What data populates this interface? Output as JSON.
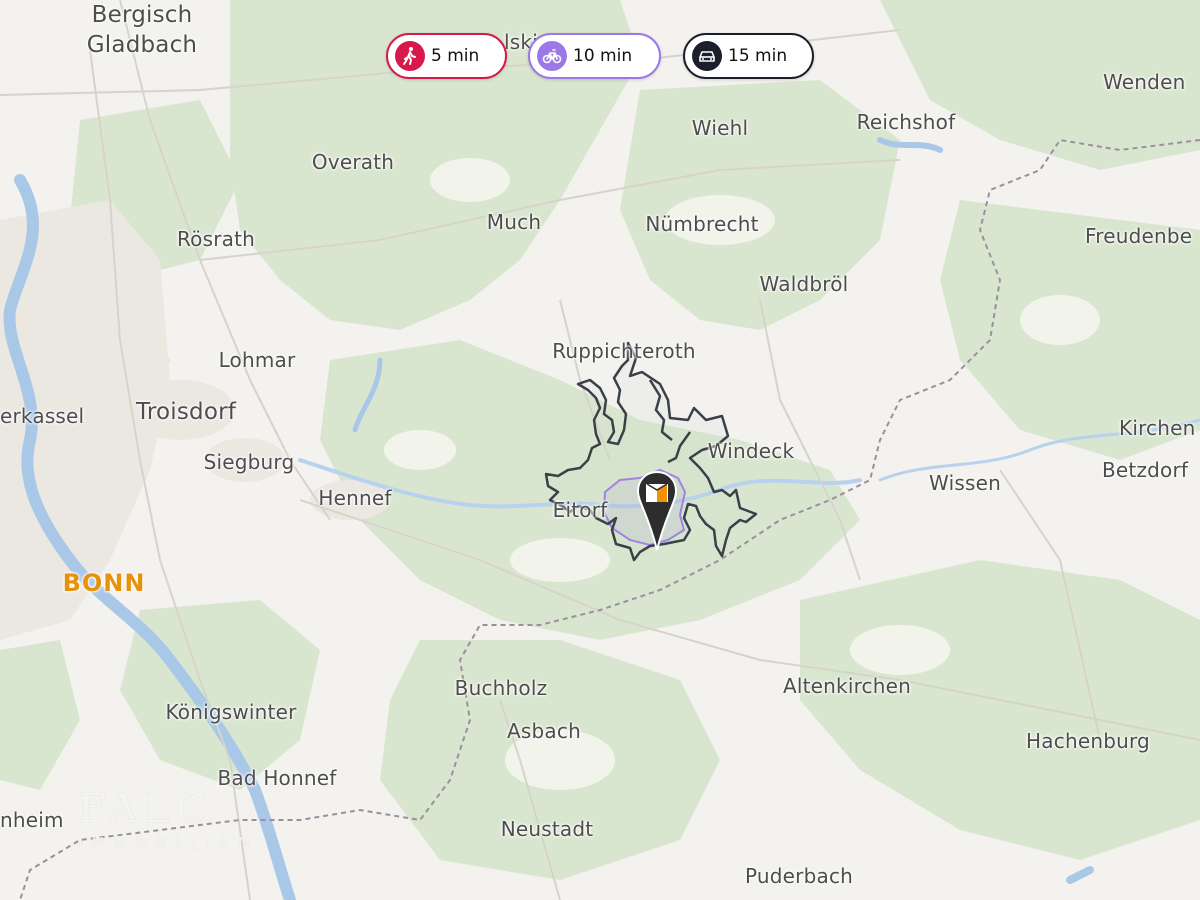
{
  "travel_modes": [
    {
      "mode": "walk",
      "icon": "walking-person-icon",
      "label": "5 min",
      "color": "#d8174b"
    },
    {
      "mode": "bike",
      "icon": "bicycle-icon",
      "label": "10 min",
      "color": "#9c78e6"
    },
    {
      "mode": "car",
      "icon": "car-icon",
      "label": "15 min",
      "color": "#1a1f2b"
    }
  ],
  "places": {
    "bergisch_gladbach": "Bergisch\nGladbach",
    "overath": "Overath",
    "much": "Much",
    "nuembrecht": "Nümbrecht",
    "wiehl": "Wiehl",
    "reichshof": "Reichshof",
    "wenden": "Wenden",
    "freudenberg": "Freudenbe",
    "waldbroel": "Waldbröl",
    "roesrath": "Rösrath",
    "lohmar": "Lohmar",
    "ruppichteroth": "Ruppichteroth",
    "troisdorf": "Troisdorf",
    "niederkassel": "erkassel",
    "siegburg": "Siegburg",
    "hennef": "Hennef",
    "eitorf": "Eitorf",
    "windeck": "Windeck",
    "wissen": "Wissen",
    "kirchen": "Kirchen",
    "betzdorf": "Betzdorf",
    "bonn": "BONN",
    "koenigswinter": "Königswinter",
    "bad_honnef": "Bad Honnef",
    "buchholz": "Buchholz",
    "asbach": "Asbach",
    "altenkirchen": "Altenkirchen",
    "hachenburg": "Hachenburg",
    "neustadt": "Neustadt",
    "puderbach": "Puderbach",
    "bornheim": "nheim",
    "partial_top": "lski"
  },
  "watermark": {
    "line1": "FALC",
    "line2": "IMMOBILIEN"
  },
  "marker": {
    "icon": "property-location-pin-icon",
    "accent": "#f39200"
  },
  "colors": {
    "land": "#f3f2ee",
    "forest": "#d9e6cf",
    "water": "#a9c8e8",
    "border": "#9a8fa0",
    "river": "#b7d2ee"
  }
}
